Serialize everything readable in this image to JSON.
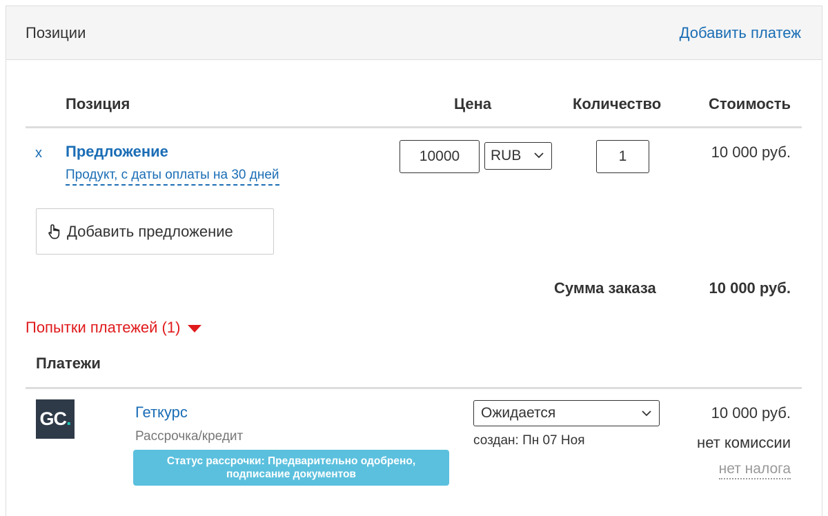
{
  "header": {
    "title": "Позиции",
    "add_payment_link": "Добавить платеж"
  },
  "table": {
    "columns": {
      "position": "Позиция",
      "price": "Цена",
      "quantity": "Количество",
      "cost": "Стоимость"
    },
    "rows": [
      {
        "remove_label": "x",
        "title": "Предложение",
        "subtitle": "Продукт, с даты оплаты на 30 дней",
        "price_value": "10000",
        "currency": "RUB",
        "quantity_value": "1",
        "cost": "10 000 руб."
      }
    ]
  },
  "add_offer_button": "Добавить предложение",
  "summary": {
    "label": "Сумма заказа",
    "value": "10 000 руб."
  },
  "payment_attempts": {
    "label": "Попытки платежей (1)"
  },
  "payments": {
    "heading": "Платежи",
    "items": [
      {
        "logo_text": "GC",
        "logo_dot": ".",
        "provider": "Геткурс",
        "type": "Рассрочка/кредит",
        "status_badge_line1": "Статус рассрочки: Предварительно одобрено,",
        "status_badge_line2": "подписание документов",
        "status": "Ожидается",
        "created": "создан: Пн 07 Ноя",
        "amount": "10 000 руб.",
        "commission": "нет комиссии",
        "tax": "нет налога"
      }
    ]
  },
  "colors": {
    "link": "#1a6db5",
    "danger": "#e0191b",
    "info_badge": "#5bc0de",
    "logo_bg": "#2e3a48",
    "logo_accent": "#1fc6b8"
  },
  "icons": {
    "remove": "close-x",
    "add_offer": "hand-pointer-icon",
    "attempts_toggle": "caret-down-icon",
    "select": "chevron-down-icon"
  }
}
